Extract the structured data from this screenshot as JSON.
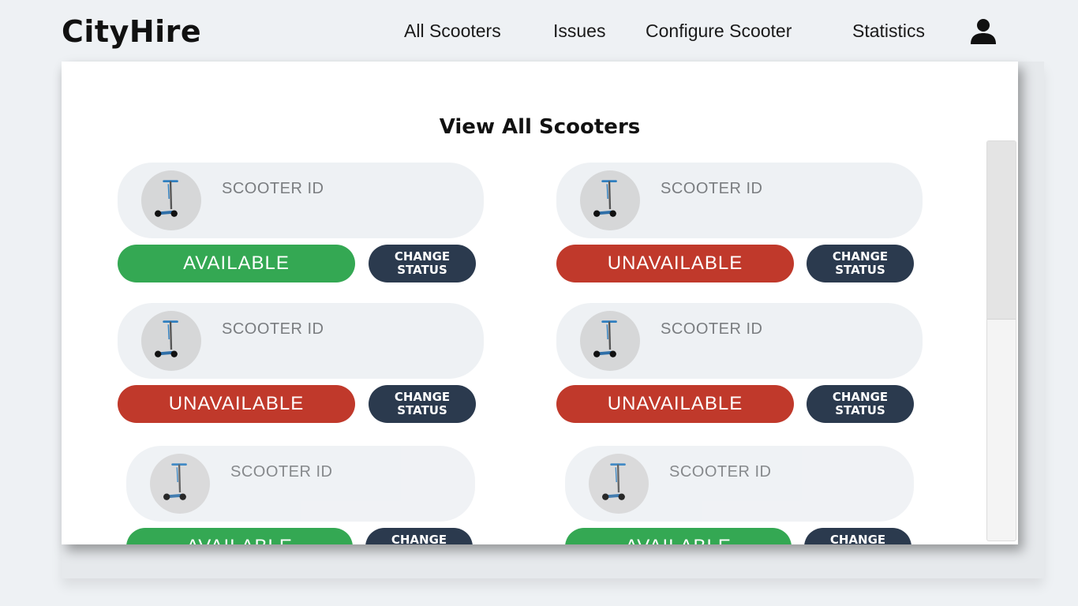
{
  "header": {
    "logo": "CityHire",
    "nav": [
      "All Scooters",
      "Issues",
      "Configure Scooter",
      "Statistics"
    ]
  },
  "panel": {
    "title": "View All Scooters"
  },
  "scooters": [
    {
      "id_label": "SCOOTER ID",
      "status": "AVAILABLE",
      "button": "CHANGE STATUS"
    },
    {
      "id_label": "SCOOTER ID",
      "status": "UNAVAILABLE",
      "button": "CHANGE STATUS"
    },
    {
      "id_label": "SCOOTER ID",
      "status": "UNAVAILABLE",
      "button": "CHANGE STATUS"
    },
    {
      "id_label": "SCOOTER ID",
      "status": "UNAVAILABLE",
      "button": "CHANGE STATUS"
    },
    {
      "id_label": "SCOOTER ID",
      "status": "AVAILABLE",
      "button": "CHANGE STATUS"
    },
    {
      "id_label": "SCOOTER ID",
      "status": "AVAILABLE",
      "button": "CHANGE STATUS"
    }
  ],
  "colors": {
    "available": "#34a853",
    "unavailable": "#c0392b",
    "button": "#2b3a4e"
  },
  "icons": [
    "user-icon",
    "scooter-icon"
  ]
}
